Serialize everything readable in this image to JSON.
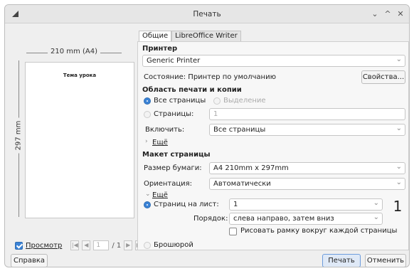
{
  "window": {
    "title": "Печать",
    "controls": [
      "⌄",
      "^",
      "✕"
    ]
  },
  "preview": {
    "width_label": "210 mm (A4)",
    "height_label": "297 mm",
    "page_title": "Тема урока",
    "preview_checkbox_label": "Просмотр",
    "preview_checked": true,
    "page_current": "1",
    "page_total": "/ 1"
  },
  "tabs": [
    {
      "label": "Общие",
      "active": true
    },
    {
      "label": "LibreOffice Writer",
      "active": false
    }
  ],
  "printer": {
    "section": "Принтер",
    "selected": "Generic Printer",
    "status": "Состояние: Принтер по умолчанию",
    "properties_button": "Свойства..."
  },
  "range": {
    "section": "Область печати и копии",
    "all_pages": "Все страницы",
    "selection": "Выделение",
    "pages_label": "Страницы:",
    "pages_value": "1",
    "include_label": "Включить:",
    "include_value": "Все страницы",
    "more": "Ещё"
  },
  "layout": {
    "section": "Макет страницы",
    "paper_label": "Размер бумаги:",
    "paper_value": "A4 210mm x 297mm",
    "orientation_label": "Ориентация:",
    "orientation_value": "Автоматически",
    "more": "Ещё",
    "pages_per_sheet_label": "Страниц на лист:",
    "pages_per_sheet_value": "1",
    "order_label": "Порядок:",
    "order_value": "слева направо, затем вниз",
    "border_label": "Рисовать рамку вокруг каждой страницы",
    "preview_number": "1",
    "brochure": "Брошюрой"
  },
  "footer": {
    "help": "Справка",
    "print": "Печать",
    "cancel": "Отменить"
  }
}
